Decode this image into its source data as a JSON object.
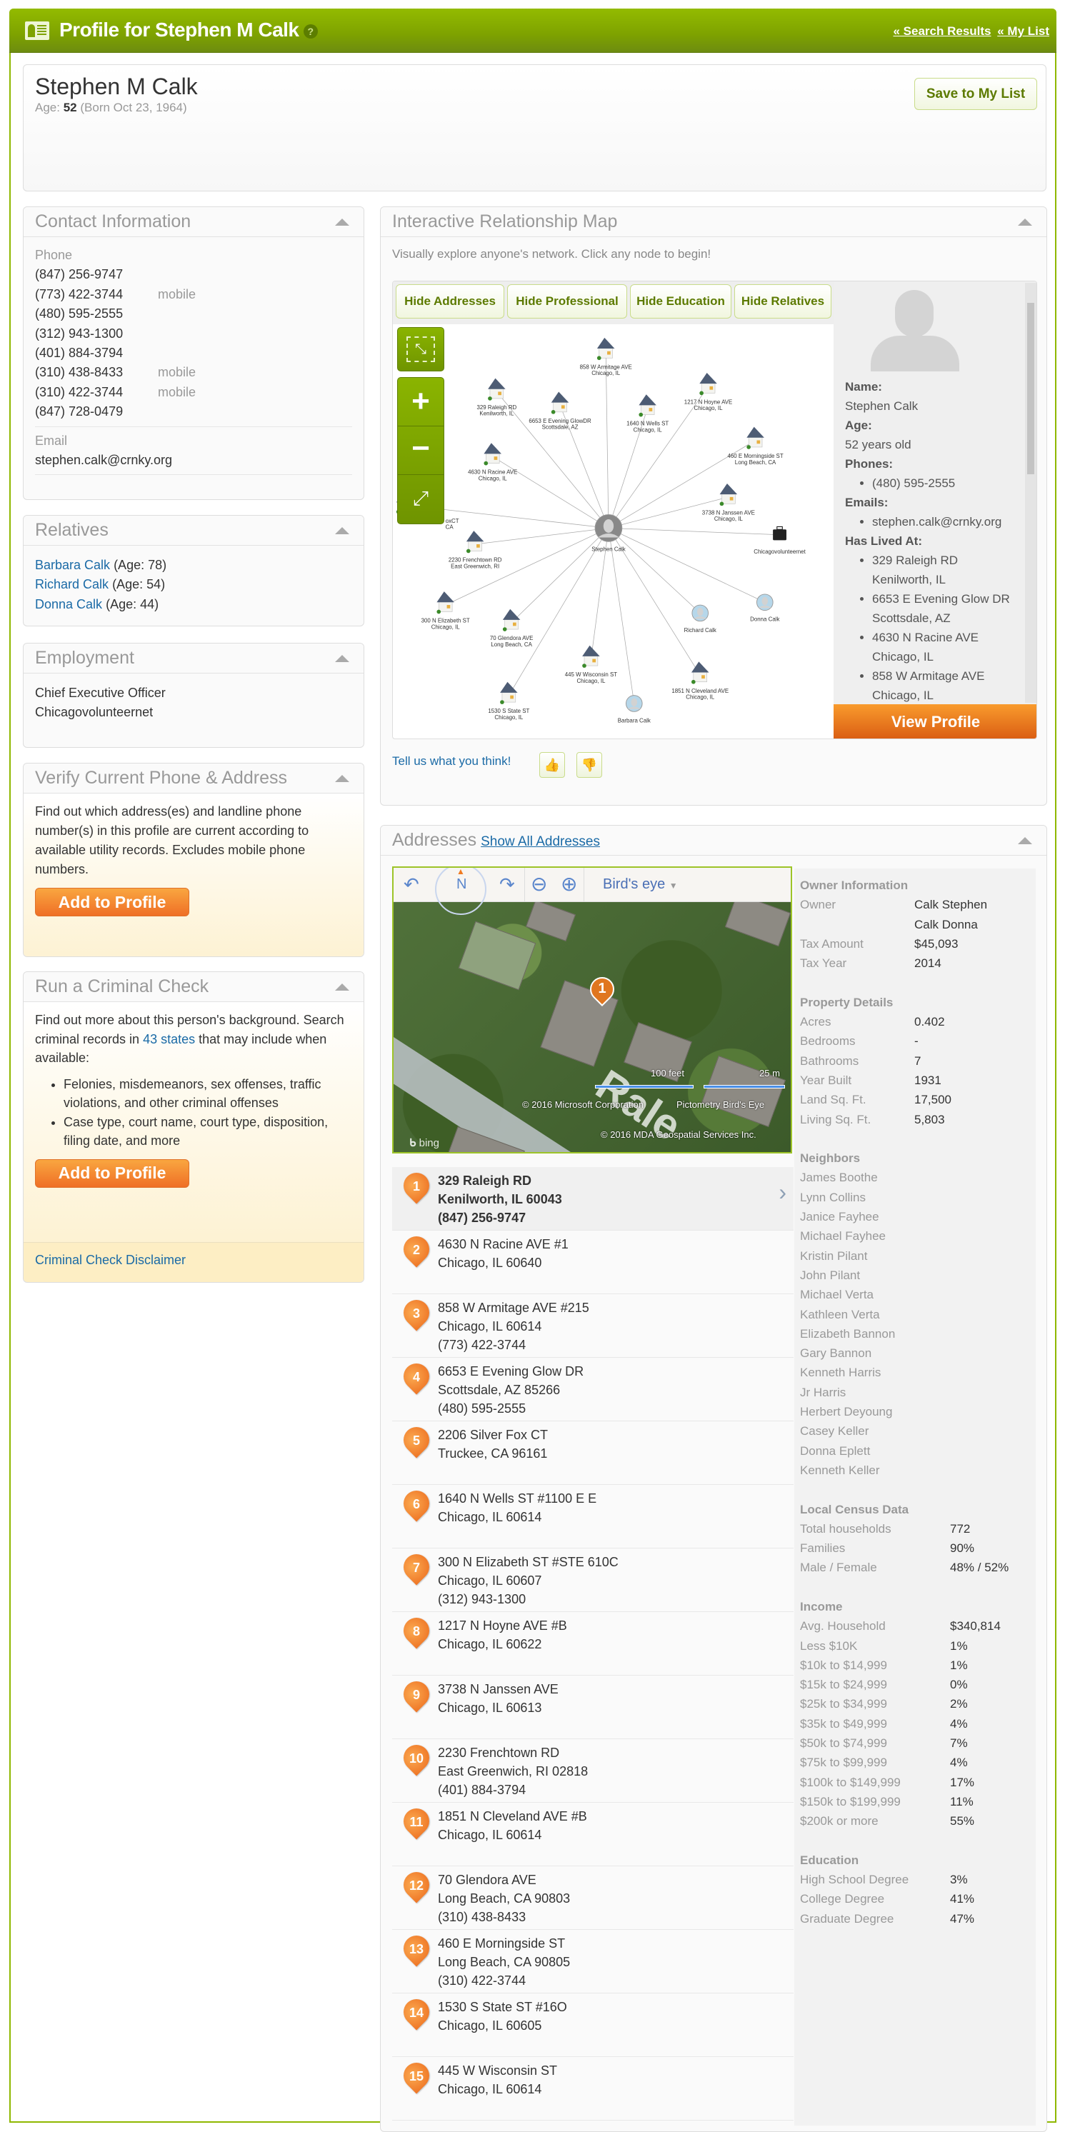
{
  "header": {
    "title": "Profile for Stephen M Calk",
    "help": "?",
    "links": [
      "« Search Results",
      "« My List"
    ],
    "icon": "profile-card-icon"
  },
  "profile": {
    "name": "Stephen M Calk",
    "age_label": "Age:",
    "age": "52",
    "born": "(Born Oct 23, 1964)",
    "save_button": "Save to My List"
  },
  "contact": {
    "title": "Contact Information",
    "phone_label": "Phone",
    "phones": [
      {
        "number": "(847) 256-9747",
        "type": ""
      },
      {
        "number": "(773) 422-3744",
        "type": "mobile"
      },
      {
        "number": "(480) 595-2555",
        "type": ""
      },
      {
        "number": "(312) 943-1300",
        "type": ""
      },
      {
        "number": "(401) 884-3794",
        "type": ""
      },
      {
        "number": "(310) 438-8433",
        "type": "mobile"
      },
      {
        "number": "(310) 422-3744",
        "type": "mobile"
      },
      {
        "number": "(847) 728-0479",
        "type": ""
      }
    ],
    "email_label": "Email",
    "email": "stephen.calk@crnky.org"
  },
  "relatives": {
    "title": "Relatives",
    "items": [
      {
        "name": "Barbara Calk",
        "age": "(Age: 78)"
      },
      {
        "name": "Richard Calk",
        "age": "(Age: 54)"
      },
      {
        "name": "Donna Calk",
        "age": "(Age: 44)"
      }
    ]
  },
  "employment": {
    "title": "Employment",
    "lines": [
      "Chief Executive Officer",
      "Chicagovolunteernet"
    ]
  },
  "verify": {
    "title": "Verify Current Phone & Address",
    "text": "Find out which address(es) and landline phone number(s) in this profile are current according to available utility records. Excludes mobile phone numbers.",
    "button": "Add to Profile"
  },
  "criminal": {
    "title": "Run a Criminal Check",
    "text_before": "Find out more about this person's background. Search criminal records in",
    "link": "43 states",
    "text_after": "that may include when available:",
    "bullets": [
      "Felonies, misdemeanors, sex offenses, traffic violations, and other criminal offenses",
      "Case type, court name, court type, disposition, filing date, and more"
    ],
    "button": "Add to Profile",
    "disclaimer": "Criminal Check Disclaimer"
  },
  "relmap": {
    "title": "Interactive Relationship Map",
    "subtitle": "Visually explore anyone's network. Click any node to begin!",
    "buttons": [
      "Hide Addresses",
      "Hide Professional",
      "Hide Education",
      "Hide Relatives"
    ],
    "center": "Stephen Calk",
    "nodes": [
      {
        "icon": "house-icon",
        "lines": [
          "858 W Armitage AVE",
          "Chicago, IL"
        ]
      },
      {
        "icon": "house-icon",
        "lines": [
          "329 Raleigh RD",
          "Kenilworth, IL"
        ]
      },
      {
        "icon": "house-icon",
        "lines": [
          "6653 E Evening GlowDR",
          "Scottsdale, AZ"
        ]
      },
      {
        "icon": "house-icon",
        "lines": [
          "1640 N Wells ST",
          "Chicago, IL"
        ]
      },
      {
        "icon": "house-icon",
        "lines": [
          "1217 N Hoyne AVE",
          "Chicago, IL"
        ]
      },
      {
        "icon": "house-icon",
        "lines": [
          "460 E Morningside ST",
          "Long Beach, CA"
        ]
      },
      {
        "icon": "house-icon",
        "lines": [
          "4630 N Racine AVE",
          "Chicago, IL"
        ]
      },
      {
        "icon": "house-icon",
        "lines": [
          "oxCT",
          "CA"
        ]
      },
      {
        "icon": "house-icon",
        "lines": [
          "3738 N Janssen AVE",
          "Chicago, IL"
        ]
      },
      {
        "icon": "briefcase-icon",
        "lines": [
          "Chicagovolunteernet"
        ]
      },
      {
        "icon": "house-icon",
        "lines": [
          "2230 Frenchtown RD",
          "East Greenwich, RI"
        ]
      },
      {
        "icon": "house-icon",
        "lines": [
          "300 N Elizabeth ST",
          "Chicago, IL"
        ]
      },
      {
        "icon": "house-icon",
        "lines": [
          "70 Glendora AVE",
          "Long Beach, CA"
        ]
      },
      {
        "icon": "house-icon",
        "lines": [
          "445 W Wisconsin ST",
          "Chicago, IL"
        ]
      },
      {
        "icon": "house-icon",
        "lines": [
          "1530 S State ST",
          "Chicago, IL"
        ]
      },
      {
        "icon": "house-icon",
        "lines": [
          "1851 N Cleveland AVE",
          "Chicago, IL"
        ]
      },
      {
        "icon": "person-icon",
        "lines": [
          "Richard Calk"
        ]
      },
      {
        "icon": "person-icon",
        "lines": [
          "Donna Calk"
        ]
      },
      {
        "icon": "person-icon",
        "lines": [
          "Barbara Calk"
        ]
      }
    ],
    "info": {
      "name_label": "Name:",
      "name": "Stephen Calk",
      "age_label": "Age:",
      "age": "52 years old",
      "phones_label": "Phones:",
      "phones": [
        "(480) 595-2555"
      ],
      "emails_label": "Emails:",
      "emails": [
        "stephen.calk@crnky.org"
      ],
      "lived_label": "Has Lived At:",
      "lived": [
        [
          "329 Raleigh RD",
          "Kenilworth, IL"
        ],
        [
          "6653 E Evening Glow DR",
          "Scottsdale, AZ"
        ],
        [
          "4630 N Racine AVE",
          "Chicago, IL"
        ],
        [
          "858 W Armitage AVE",
          "Chicago, IL"
        ]
      ]
    },
    "view_profile": "View Profile",
    "feedback": "Tell us what you think!"
  },
  "addresses": {
    "title": "Addresses",
    "show_all": "Show All Addresses",
    "map": {
      "view_mode": "Bird's eye",
      "compass": "N",
      "scale_ft": "100 feet",
      "scale_m": "25 m",
      "copyright_ms": "© 2016 Microsoft Corporation",
      "pictometry": "Pictometry Bird's Eye",
      "copyright_mda": "© 2016 MDA Geospatial Services Inc.",
      "bing": "bing",
      "road_label": "Rale",
      "pin": "1"
    },
    "list": [
      {
        "n": "1",
        "lines": [
          "329 Raleigh RD",
          "Kenilworth, IL 60043",
          "(847) 256-9747"
        ]
      },
      {
        "n": "2",
        "lines": [
          "4630 N Racine AVE #1",
          "Chicago, IL 60640"
        ]
      },
      {
        "n": "3",
        "lines": [
          "858 W Armitage AVE #215",
          "Chicago, IL 60614",
          "(773) 422-3744"
        ]
      },
      {
        "n": "4",
        "lines": [
          "6653 E Evening Glow DR",
          "Scottsdale, AZ 85266",
          "(480) 595-2555"
        ]
      },
      {
        "n": "5",
        "lines": [
          "2206 Silver Fox CT",
          "Truckee, CA 96161"
        ]
      },
      {
        "n": "6",
        "lines": [
          "1640 N Wells ST #1100 E E",
          "Chicago, IL 60614"
        ]
      },
      {
        "n": "7",
        "lines": [
          "300 N Elizabeth ST #STE 610C",
          "Chicago, IL 60607",
          "(312) 943-1300"
        ]
      },
      {
        "n": "8",
        "lines": [
          "1217 N Hoyne AVE #B",
          "Chicago, IL 60622"
        ]
      },
      {
        "n": "9",
        "lines": [
          "3738 N Janssen AVE",
          "Chicago, IL 60613"
        ]
      },
      {
        "n": "10",
        "lines": [
          "2230 Frenchtown RD",
          "East Greenwich, RI 02818",
          "(401) 884-3794"
        ]
      },
      {
        "n": "11",
        "lines": [
          "1851 N Cleveland AVE #B",
          "Chicago, IL 60614"
        ]
      },
      {
        "n": "12",
        "lines": [
          "70 Glendora AVE",
          "Long Beach, CA 90803",
          "(310) 438-8433"
        ]
      },
      {
        "n": "13",
        "lines": [
          "460 E Morningside ST",
          "Long Beach, CA 90805",
          "(310) 422-3744"
        ]
      },
      {
        "n": "14",
        "lines": [
          "1530 S State ST #16O",
          "Chicago, IL 60605"
        ]
      },
      {
        "n": "15",
        "lines": [
          "445 W Wisconsin ST",
          "Chicago, IL 60614"
        ]
      }
    ],
    "info": [
      {
        "title": "Owner Information",
        "rows": [
          [
            "Owner",
            "Calk Stephen"
          ],
          [
            "",
            "Calk Donna"
          ],
          [
            "Tax Amount",
            "$45,093"
          ],
          [
            "Tax Year",
            "2014"
          ]
        ]
      },
      {
        "title": "Property Details",
        "rows": [
          [
            "Acres",
            "0.402"
          ],
          [
            "Bedrooms",
            "-"
          ],
          [
            "Bathrooms",
            "7"
          ],
          [
            "Year Built",
            "1931"
          ],
          [
            "Land Sq. Ft.",
            "17,500"
          ],
          [
            "Living Sq. Ft.",
            "5,803"
          ]
        ]
      },
      {
        "title": "Neighbors",
        "rows": [
          [
            "James Boothe",
            ""
          ],
          [
            "Lynn Collins",
            ""
          ],
          [
            "Janice Fayhee",
            ""
          ],
          [
            "Michael Fayhee",
            ""
          ],
          [
            "Kristin Pilant",
            ""
          ],
          [
            "John Pilant",
            ""
          ],
          [
            "Michael Verta",
            ""
          ],
          [
            "Kathleen Verta",
            ""
          ],
          [
            "Elizabeth Bannon",
            ""
          ],
          [
            "Gary Bannon",
            ""
          ],
          [
            "Kenneth Harris",
            ""
          ],
          [
            "Jr Harris",
            ""
          ],
          [
            "Herbert Deyoung",
            ""
          ],
          [
            "Casey Keller",
            ""
          ],
          [
            "Donna Eplett",
            ""
          ],
          [
            "Kenneth Keller",
            ""
          ]
        ]
      },
      {
        "title": "Local Census Data",
        "wide": true,
        "rows": [
          [
            "Total households",
            "772"
          ],
          [
            "Families",
            "90%"
          ],
          [
            "Male / Female",
            "48% / 52%"
          ]
        ]
      },
      {
        "title": "Income",
        "wide": true,
        "rows": [
          [
            "Avg. Household",
            "$340,814"
          ],
          [
            "Less $10K",
            "1%"
          ],
          [
            "$10k to $14,999",
            "1%"
          ],
          [
            "$15k to $24,999",
            "0%"
          ],
          [
            "$25k to $34,999",
            "2%"
          ],
          [
            "$35k to $49,999",
            "4%"
          ],
          [
            "$50k to $74,999",
            "7%"
          ],
          [
            "$75k to $99,999",
            "4%"
          ],
          [
            "$100k to $149,999",
            "17%"
          ],
          [
            "$150k to $199,999",
            "11%"
          ],
          [
            "$200k or more",
            "55%"
          ]
        ]
      },
      {
        "title": "Education",
        "wide": true,
        "rows": [
          [
            "High School Degree",
            "3%"
          ],
          [
            "College Degree",
            "41%"
          ],
          [
            "Graduate Degree",
            "47%"
          ]
        ]
      }
    ]
  },
  "colors": {
    "brand_green": "#7ea200",
    "accent_orange": "#ef6f26",
    "link_blue": "#1a6aa6"
  }
}
